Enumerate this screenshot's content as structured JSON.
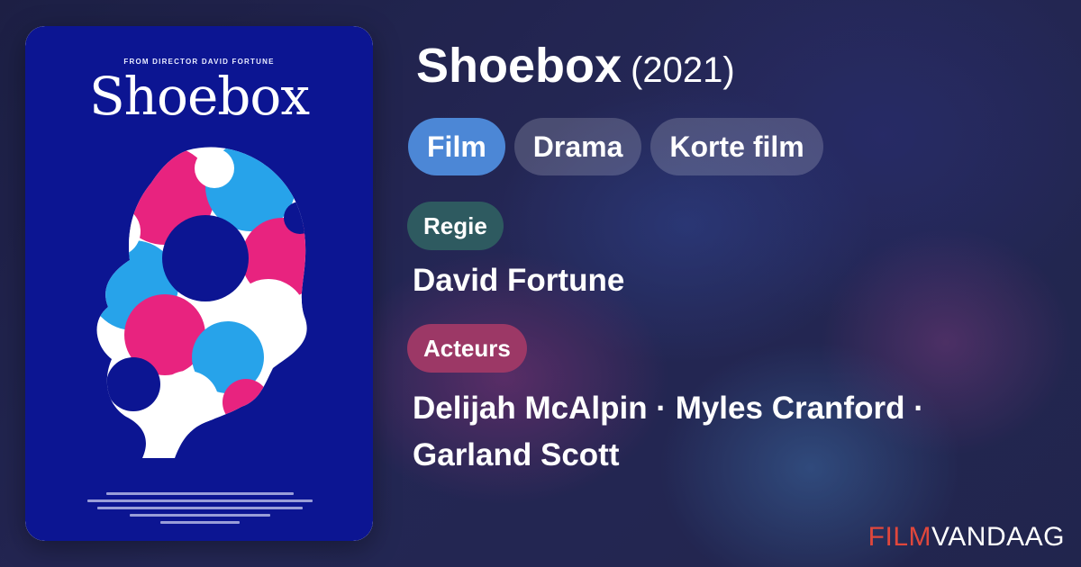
{
  "poster": {
    "tagline": "FROM DIRECTOR DAVID FORTUNE",
    "title": "Shoebox"
  },
  "movie": {
    "title": "Shoebox",
    "year": "(2021)"
  },
  "genres": [
    "Film",
    "Drama",
    "Korte film"
  ],
  "director": {
    "label": "Regie",
    "name": "David Fortune"
  },
  "cast": {
    "label": "Acteurs",
    "line1": "Delijah McAlpin · Myles Cranford ·",
    "line2": "Garland Scott"
  },
  "brand": {
    "part1": "FILM",
    "part2": "VANDAAG"
  },
  "colors": {
    "poster_bg": "#0c1592",
    "poster_pink": "#e8237f",
    "poster_blue": "#27a3ea",
    "genre_primary": "#4c87d6",
    "regie_pill": "#2e5a60",
    "acteurs_pill": "#9c3866",
    "brand_red": "#e0473c"
  }
}
